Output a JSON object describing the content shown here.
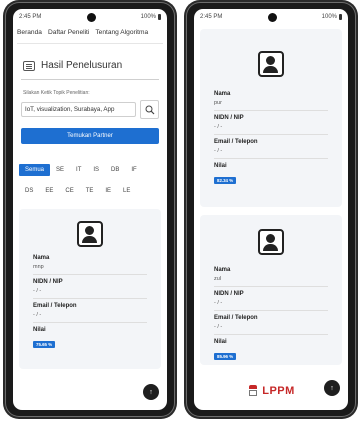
{
  "status": {
    "time": "2:45 PM",
    "battery": "100%"
  },
  "nav": {
    "items": [
      "Beranda",
      "Daftar Peneliti",
      "Tentang Algoritma"
    ]
  },
  "search_page": {
    "title": "Hasil Penelusuran",
    "label": "Silakan Ketik Topik Penelitian:",
    "input_value": "IoT, visualization, Surabaya, App",
    "button": "Temukan Partner",
    "filters": [
      "Semua",
      "SE",
      "IT",
      "IS",
      "DB",
      "IF",
      "DS",
      "EE",
      "CE",
      "TE",
      "IE",
      "LE"
    ],
    "active_filter": "Semua"
  },
  "labels": {
    "name": "Nama",
    "nidn": "NIDN / NIP",
    "contact": "Email / Telepon",
    "score": "Nilai"
  },
  "cards": [
    {
      "name": "mnp",
      "nidn": "- / -",
      "contact": "- / -",
      "score": "75.65 %"
    },
    {
      "name": "pur",
      "nidn": "- / -",
      "contact": "- / -",
      "score": "82.34 %"
    },
    {
      "name": "zul",
      "nidn": "- / -",
      "contact": "- / -",
      "score": "85.96 %"
    }
  ],
  "fab_icon": "arrow-up-icon",
  "footer": {
    "logo_text": "LPPM"
  },
  "colors": {
    "primary": "#1e6fd1",
    "card_bg": "#f3f5f8",
    "logo_red": "#c62828"
  }
}
